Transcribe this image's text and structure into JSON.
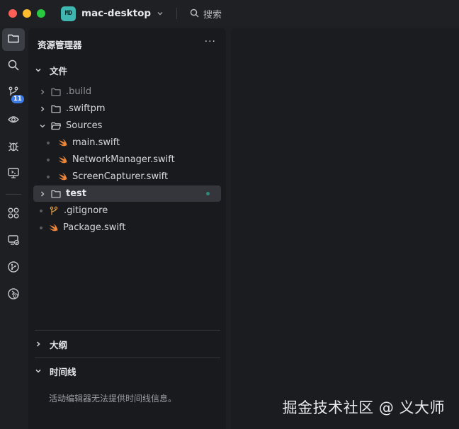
{
  "titlebar": {
    "project_badge": "MD",
    "project_name": "mac-desktop",
    "search_label": "搜索"
  },
  "activity_bar": {
    "items": [
      {
        "icon": "files-icon",
        "active": true
      },
      {
        "icon": "search-icon"
      },
      {
        "icon": "source-control-icon",
        "badge": "11"
      },
      {
        "icon": "eye-icon"
      },
      {
        "icon": "debug-icon"
      },
      {
        "icon": "remote-monitor-icon"
      },
      {
        "icon": "extensions-icon"
      },
      {
        "icon": "remote-explorer-icon"
      },
      {
        "icon": "git-graph-icon"
      },
      {
        "icon": "settings-sync-icon"
      }
    ]
  },
  "explorer": {
    "title": "资源管理器",
    "more": "···",
    "files_section": "文件",
    "tree": [
      {
        "label": ".build",
        "type": "folder",
        "depth": 0,
        "dim": true
      },
      {
        "label": ".swiftpm",
        "type": "folder",
        "depth": 0
      },
      {
        "label": "Sources",
        "type": "folder-open",
        "depth": 0
      },
      {
        "label": "main.swift",
        "type": "swift",
        "depth": 1
      },
      {
        "label": "NetworkManager.swift",
        "type": "swift",
        "depth": 1
      },
      {
        "label": "ScreenCapturer.swift",
        "type": "swift",
        "depth": 1
      },
      {
        "label": "test",
        "type": "folder",
        "depth": 0,
        "selected": true
      },
      {
        "label": ".gitignore",
        "type": "git",
        "depth": 0
      },
      {
        "label": "Package.swift",
        "type": "swift",
        "depth": 0
      }
    ],
    "outline_section": "大纲",
    "timeline_section": "时间线",
    "timeline_message": "活动编辑器无法提供时间线信息。"
  },
  "watermark": "掘金技术社区 @ 义大师",
  "colors": {
    "accent": "#3d7be6",
    "badge": "#3fb6b0",
    "swift": "#f0883e",
    "modified": "#2a8b7a"
  }
}
